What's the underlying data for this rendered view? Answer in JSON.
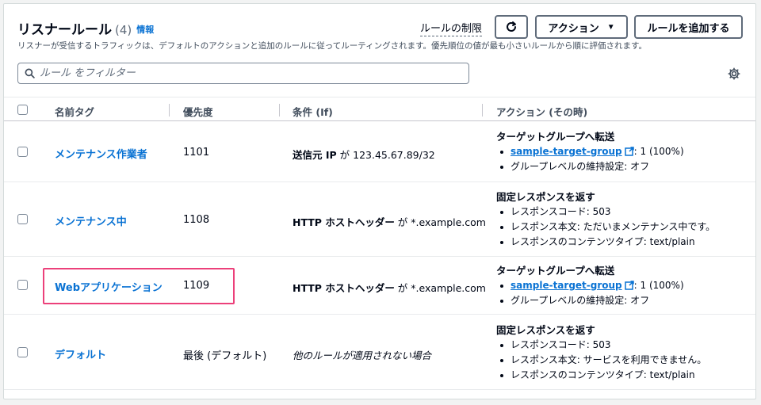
{
  "header": {
    "title": "リスナールール",
    "count": "(4)",
    "info": "情報",
    "rule_limit": "ルールの制限",
    "actions_label": "アクション",
    "add_rule_label": "ルールを追加する",
    "description": "リスナーが受信するトラフィックは、デフォルトのアクションと追加のルールに従ってルーティングされます。優先順位の値が最も小さいルールから順に評価されます。"
  },
  "search": {
    "placeholder": "ルール をフィルター"
  },
  "columns": {
    "name": "名前タグ",
    "priority": "優先度",
    "condition": "条件 (If)",
    "action": "アクション (その時)"
  },
  "rows": [
    {
      "name": "メンテナンス作業者",
      "priority": "1101",
      "condition": {
        "bold": "送信元 IP",
        "rest": " が 123.45.67.89/32"
      },
      "action_title": "ターゲットグループへ転送",
      "target_group": "sample-target-group",
      "weight": ": 1 (100%)",
      "stickiness": "グループレベルの維持設定: オフ"
    },
    {
      "name": "メンテナンス中",
      "priority": "1108",
      "condition": {
        "bold": "HTTP ホストヘッダー",
        "rest": " が *.example.com"
      },
      "action_title": "固定レスポンスを返す",
      "items": [
        "レスポンスコード: 503",
        "レスポンス本文: ただいまメンテナンス中です。",
        "レスポンスのコンテンツタイプ: text/plain"
      ]
    },
    {
      "name": "Webアプリケーション",
      "priority": "1109",
      "condition": {
        "bold": "HTTP ホストヘッダー",
        "rest": " が *.example.com"
      },
      "action_title": "ターゲットグループへ転送",
      "target_group": "sample-target-group",
      "weight": ": 1 (100%)",
      "stickiness": "グループレベルの維持設定: オフ"
    },
    {
      "name": "デフォルト",
      "priority": "最後 (デフォルト)",
      "condition_italic": "他のルールが適用されない場合",
      "action_title": "固定レスポンスを返す",
      "items": [
        "レスポンスコード: 503",
        "レスポンス本文: サービスを利用できません。",
        "レスポンスのコンテンツタイプ: text/plain"
      ]
    }
  ],
  "colors": {
    "link": "#0972d3",
    "highlight": "#ec407a",
    "border": "#d5dbdb"
  },
  "icons": [
    "refresh-icon",
    "caret-down-icon",
    "search-icon",
    "gear-icon",
    "external-link-icon"
  ]
}
